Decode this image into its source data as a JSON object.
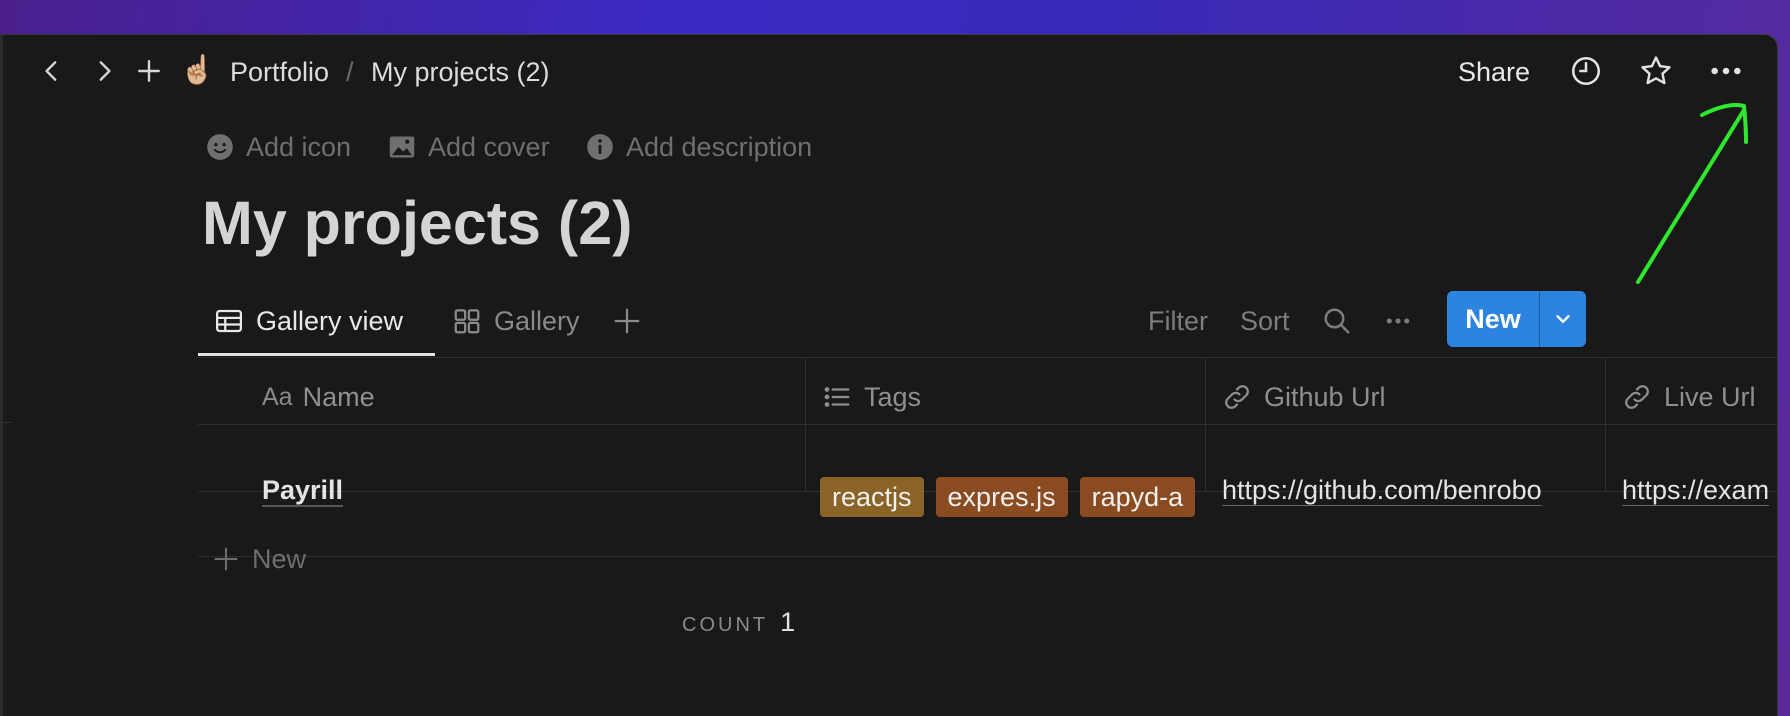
{
  "topbar": {
    "breadcrumb_emoji": "☝🏼",
    "breadcrumb_root": "Portfolio",
    "breadcrumb_separator": "/",
    "breadcrumb_current": "My projects (2)",
    "share_label": "Share"
  },
  "page": {
    "meta_actions": [
      "Add icon",
      "Add cover",
      "Add description"
    ],
    "title": "My projects (2)"
  },
  "views": {
    "active_tab": "Gallery view",
    "second_tab": "Gallery",
    "filter_label": "Filter",
    "sort_label": "Sort",
    "new_button_label": "New"
  },
  "table": {
    "columns": [
      {
        "icon_text": "Aa",
        "label": "Name"
      },
      {
        "icon": "list-icon",
        "label": "Tags"
      },
      {
        "icon": "link-icon",
        "label": "Github Url"
      },
      {
        "icon": "link-icon",
        "label": "Live Url"
      }
    ],
    "rows": [
      {
        "name": "Payrill",
        "tags": [
          {
            "label": "reactjs",
            "color": "#8a6327"
          },
          {
            "label": "expres.js",
            "color": "#8a4b21"
          },
          {
            "label": "rapyd-a",
            "color": "#8a4b21"
          }
        ],
        "github_url": "https://github.com/benrobo",
        "live_url": "https://exam"
      }
    ],
    "add_row_label": "New",
    "count_label": "COUNT",
    "count_value": "1"
  },
  "colors": {
    "accent_blue": "#2d83e0",
    "annotation_arrow": "#2ee82e",
    "background": "#191919"
  }
}
